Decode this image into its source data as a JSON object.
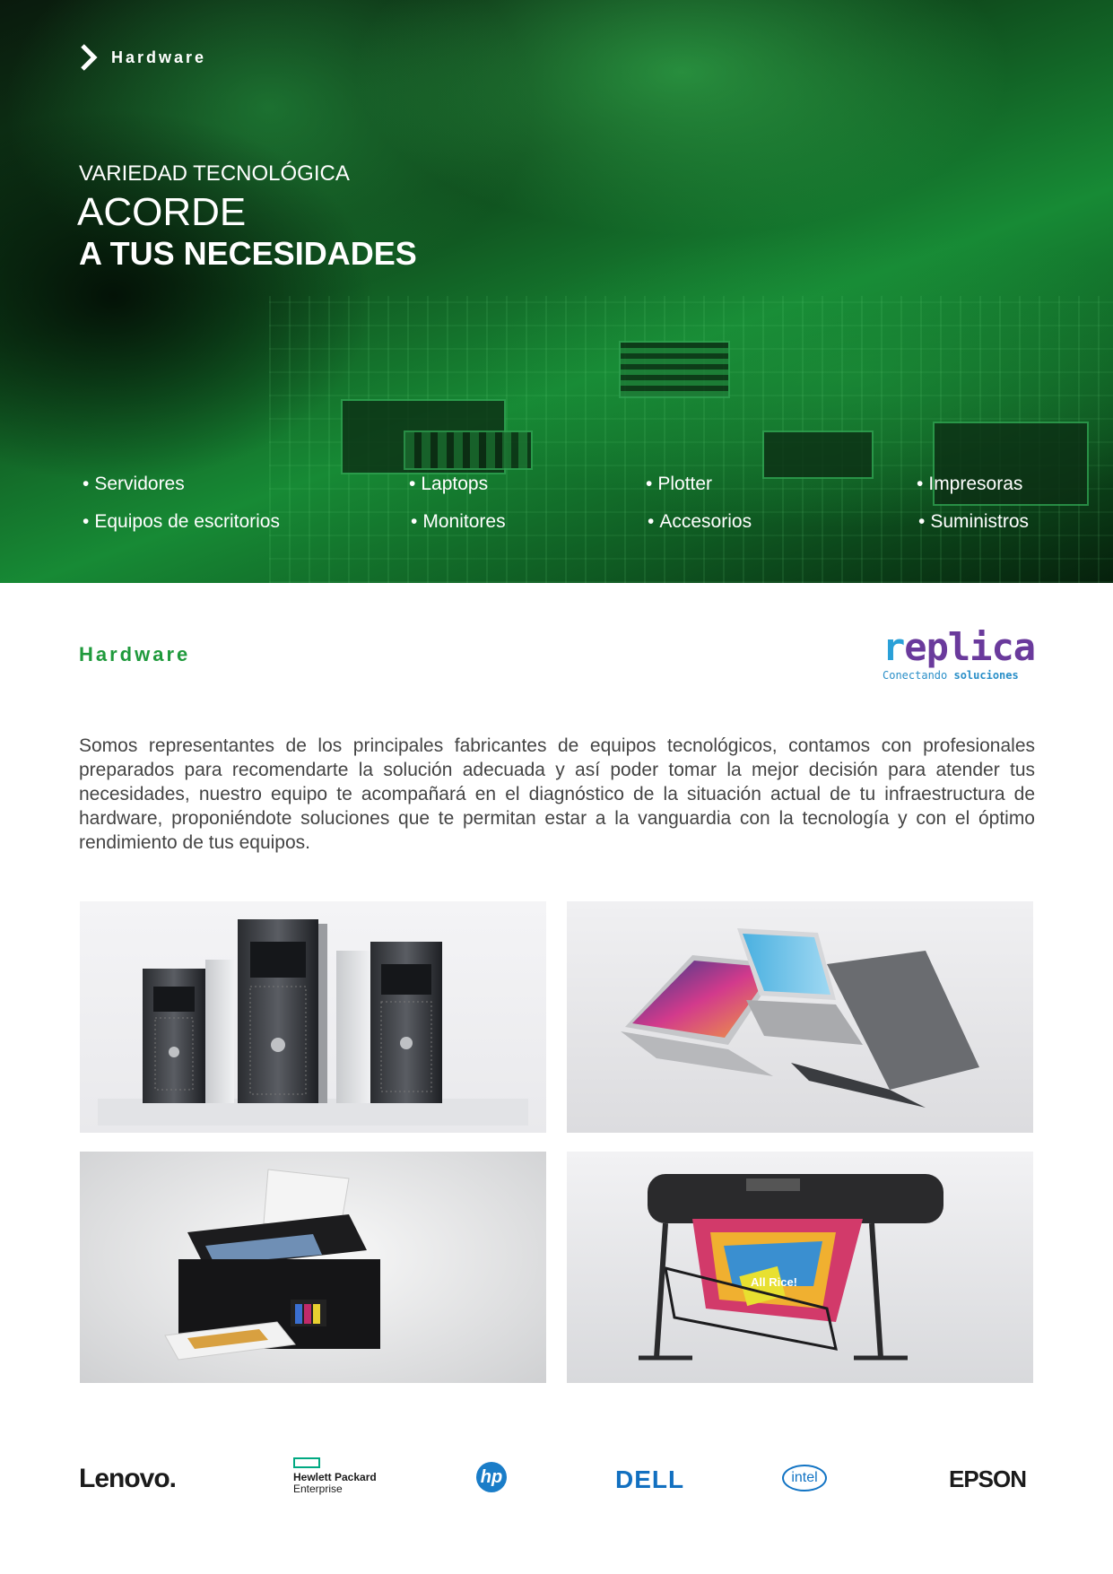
{
  "hero": {
    "breadcrumb": "Hardware",
    "pre_title": "VARIEDAD TECNOLÓGICA",
    "title_line1": "ACORDE",
    "title_line2": "A TUS NECESIDADES",
    "items": [
      "Servidores",
      "Equipos de escritorios",
      "Laptops",
      "Monitores",
      "Plotter",
      "Accesorios",
      "Impresoras",
      "Suministros"
    ]
  },
  "section": {
    "title": "Hardware",
    "body": "Somos representantes de los principales fabricantes de equipos tecnológicos, contamos con profesionales preparados para recomendarte la solución adecuada y así poder tomar la mejor decisión para atender tus necesidades, nuestro equipo te acompañará en el diagnóstico de la situación actual de tu infraestructura de hardware, proponiéndote soluciones que te permitan estar a la vanguardia con la tecnología y con el óptimo rendimiento de tus equipos."
  },
  "logo": {
    "word_first": "r",
    "word_rest": "eplica",
    "tagline_a": "Conectando",
    "tagline_b": "soluciones"
  },
  "printer_label": "All Rice!",
  "brands": {
    "lenovo": "Lenovo.",
    "hpe_line1": "Hewlett Packard",
    "hpe_line2": "Enterprise",
    "hp": "hp",
    "dell": "DELL",
    "intel": "intel",
    "epson": "EPSON"
  },
  "colors": {
    "accent_green": "#1f9a3c",
    "logo_purple": "#6a3a9c",
    "logo_blue": "#2a8fc8"
  }
}
